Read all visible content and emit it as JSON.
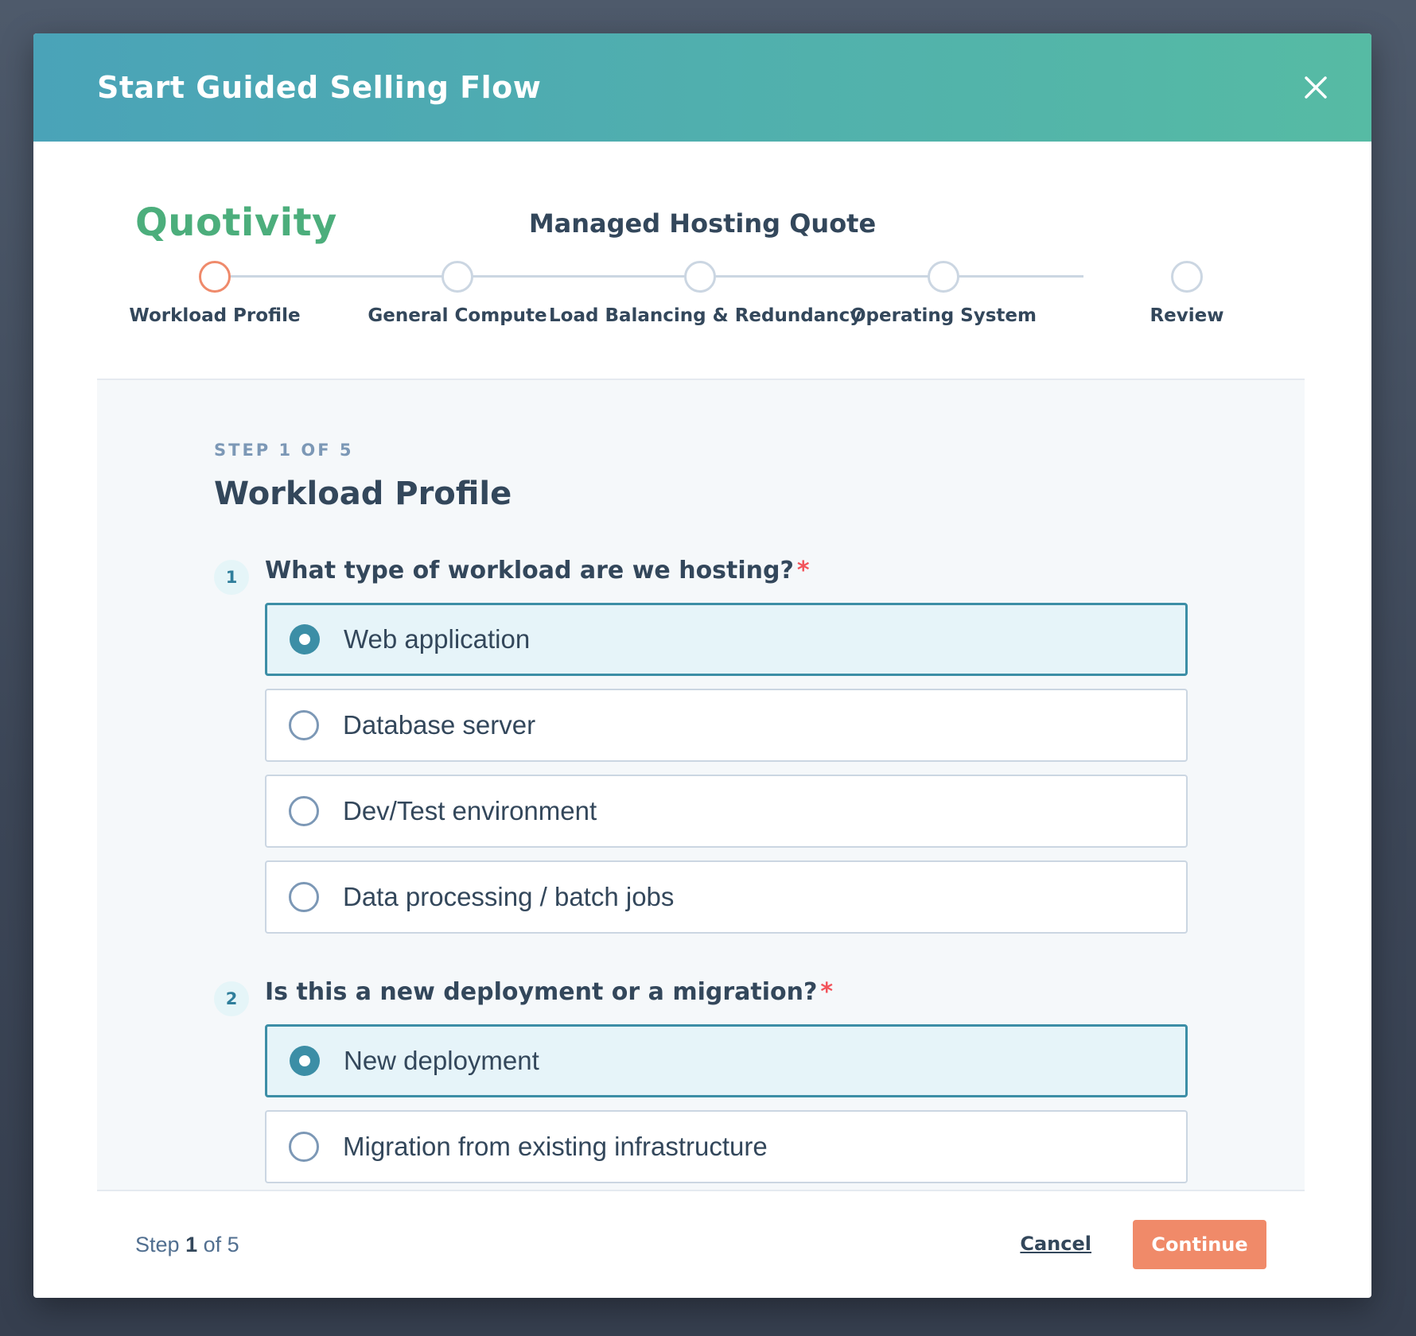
{
  "modal": {
    "title": "Start Guided Selling Flow",
    "close_icon": "close-icon"
  },
  "brand": {
    "logo_text": "Quotivity",
    "logo_color": "#4cae7c"
  },
  "quote": {
    "title": "Managed Hosting Quote"
  },
  "stepper": {
    "steps": [
      {
        "label": "Workload Profile",
        "active": true
      },
      {
        "label": "General Compute",
        "active": false
      },
      {
        "label": "Load Balancing & Redundancy",
        "active": false
      },
      {
        "label": "Operating System",
        "active": false
      },
      {
        "label": "Review",
        "active": false
      }
    ],
    "active_color": "#ef8a6b"
  },
  "section": {
    "eyebrow": "STEP 1 OF 5",
    "title": "Workload Profile"
  },
  "questions": [
    {
      "number": "1",
      "text": "What type of workload are we hosting?",
      "required_mark": "*",
      "options": [
        {
          "label": "Web application",
          "selected": true
        },
        {
          "label": "Database server",
          "selected": false
        },
        {
          "label": "Dev/Test environment",
          "selected": false
        },
        {
          "label": "Data processing / batch jobs",
          "selected": false
        }
      ]
    },
    {
      "number": "2",
      "text": "Is this a new deployment or a migration?",
      "required_mark": "*",
      "options": [
        {
          "label": "New deployment",
          "selected": true
        },
        {
          "label": "Migration from existing infrastructure",
          "selected": false
        }
      ]
    }
  ],
  "footer": {
    "step_prefix": "Step",
    "step_current": "1",
    "step_suffix": "of 5",
    "cancel_label": "Cancel",
    "continue_label": "Continue",
    "continue_color": "#f08a69"
  },
  "colors": {
    "header_start": "#4aa3b8",
    "header_end": "#56bba4",
    "selected_border": "#3c8ea6",
    "selected_bg": "#e6f4f9",
    "text": "#33475b",
    "required": "#f2545b"
  }
}
